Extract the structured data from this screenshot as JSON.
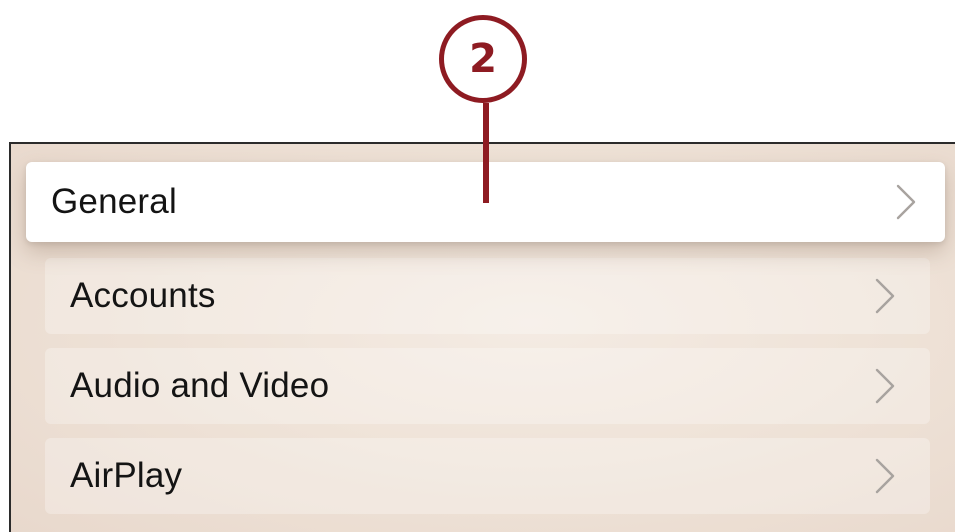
{
  "callout": {
    "number": "2"
  },
  "settings_menu": {
    "items": [
      {
        "label": "General",
        "focused": true
      },
      {
        "label": "Accounts",
        "focused": false
      },
      {
        "label": "Audio and Video",
        "focused": false
      },
      {
        "label": "AirPlay",
        "focused": false
      }
    ],
    "chevron_icon": "chevron-right-icon"
  },
  "colors": {
    "callout": "#8e1b22",
    "focused_row": "#ffffff",
    "background": "#efe3d8",
    "text": "#141414",
    "chevron": "#a8a39f"
  }
}
